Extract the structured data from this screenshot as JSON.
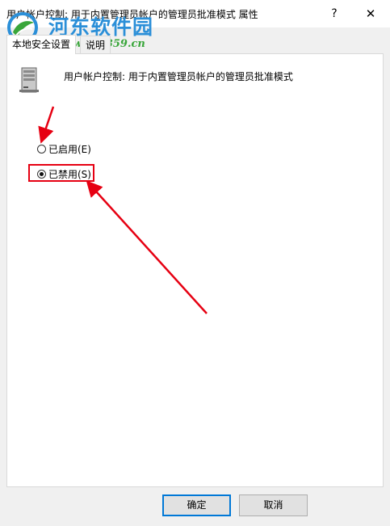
{
  "window": {
    "title": "用户帐户控制: 用于内置管理员帐户的管理员批准模式 属性",
    "help_glyph": "?",
    "close_glyph": "✕"
  },
  "watermark": {
    "site_name": "河东软件园",
    "url": "www.pc0359.cn"
  },
  "tabs": [
    {
      "label": "本地安全设置",
      "selected": true
    },
    {
      "label": "说明",
      "selected": false
    }
  ],
  "policy": {
    "icon": "server-policy-icon",
    "name": "用户帐户控制: 用于内置管理员帐户的管理员批准模式"
  },
  "options": {
    "enabled": {
      "label": "已启用(E)",
      "checked": false
    },
    "disabled": {
      "label": "已禁用(S)",
      "checked": true
    }
  },
  "annotations": {
    "color": "#e60012"
  },
  "buttons": {
    "ok": "确定",
    "cancel": "取消"
  }
}
